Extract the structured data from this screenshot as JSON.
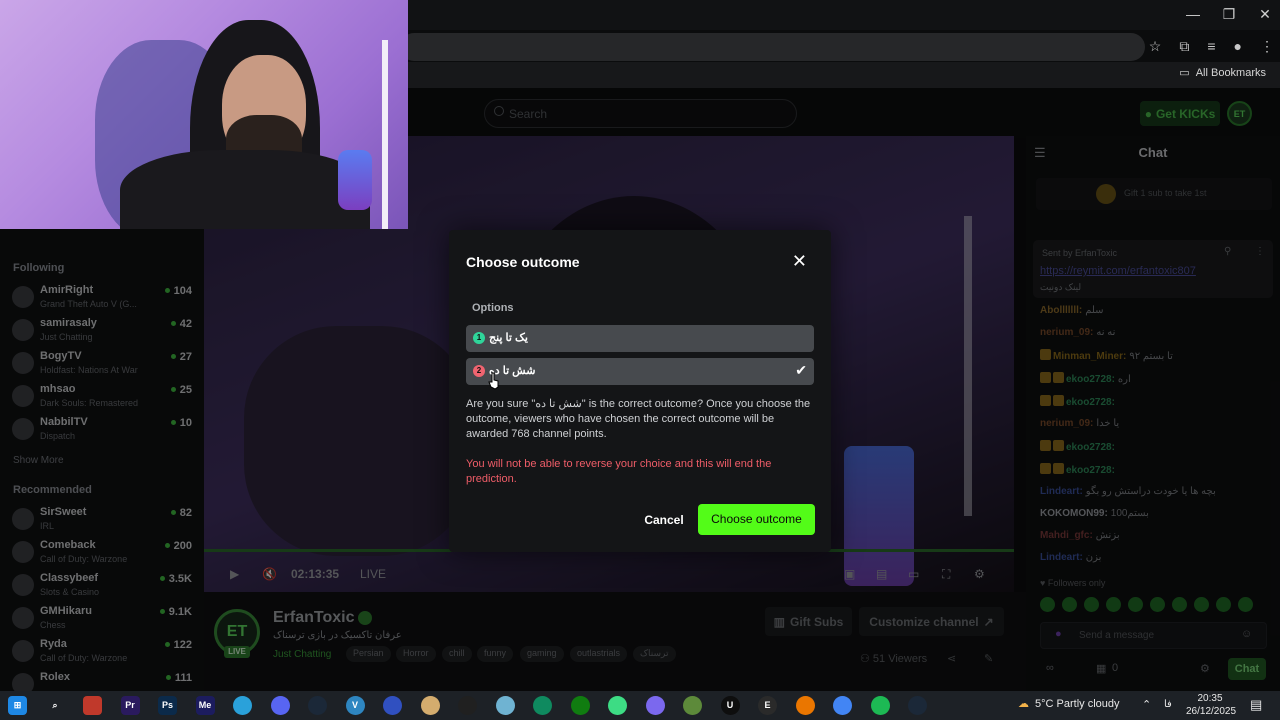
{
  "browser": {
    "bookmarks_label": "All Bookmarks",
    "window_controls": [
      "—",
      "❐",
      "✕"
    ]
  },
  "site": {
    "search_placeholder": "Search",
    "get_kicks_label": "Get KICKs",
    "avatar_initials": "ET"
  },
  "sidebar": {
    "following_heading": "Following",
    "following": [
      {
        "name": "AmirRight",
        "category": "Grand Theft Auto V (G...",
        "count": "104"
      },
      {
        "name": "samirasaly",
        "category": "Just Chatting",
        "count": "42"
      },
      {
        "name": "BogyTV",
        "category": "Holdfast: Nations At War",
        "count": "27"
      },
      {
        "name": "mhsao",
        "category": "Dark Souls: Remastered",
        "count": "25"
      },
      {
        "name": "NabbilTV",
        "category": "Dispatch",
        "count": "10"
      }
    ],
    "show_more": "Show More",
    "recommended_heading": "Recommended",
    "recommended": [
      {
        "name": "SirSweet",
        "category": "IRL",
        "count": "82"
      },
      {
        "name": "Comeback",
        "category": "Call of Duty: Warzone",
        "count": "200"
      },
      {
        "name": "Classybeef",
        "category": "Slots & Casino",
        "count": "3.5K"
      },
      {
        "name": "GMHikaru",
        "category": "Chess",
        "count": "9.1K"
      },
      {
        "name": "Ryda",
        "category": "Call of Duty: Warzone",
        "count": "122"
      },
      {
        "name": "Rolex",
        "category": "",
        "count": "111"
      }
    ]
  },
  "player": {
    "time": "02:13:35",
    "live_label": "LIVE"
  },
  "channel": {
    "name": "ErfanToxic",
    "avatar_text": "ET",
    "live_badge": "LIVE",
    "title": "عرفان تاکسیک در بازی ترسناک",
    "category": "Just Chatting",
    "tags": [
      "Persian",
      "Horror",
      "chill",
      "funny",
      "gaming",
      "outlastrials",
      "ترسناک"
    ],
    "gift_subs": "Gift Subs",
    "customize": "Customize channel",
    "viewers": "51 Viewers"
  },
  "chat": {
    "title": "Chat",
    "gift_banner": "Gift 1 sub to take 1st",
    "pinned_sender": "Sent by  ErfanToxic",
    "pinned_link": "https://reymit.com/erfantoxic807",
    "pinned_text": "لینک دونیت",
    "messages": [
      {
        "user": "Abolllllll:",
        "text": "سلم",
        "color": "#8c6a2a",
        "badges": 0
      },
      {
        "user": "nerium_09:",
        "text": "نه نه",
        "color": "#7a4b2a",
        "badges": 0
      },
      {
        "user": "Minman_Miner:",
        "text": "تا بستم ۹۲",
        "color": "#8a6a1a",
        "badges": 1
      },
      {
        "user": "ekoo2728:",
        "text": "اره",
        "color": "#2f8a5a",
        "badges": 2
      },
      {
        "user": "ekoo2728:",
        "text": "",
        "color": "#2f8a5a",
        "badges": 2
      },
      {
        "user": "nerium_09:",
        "text": "یا خدا",
        "color": "#7a4b2a",
        "badges": 0
      },
      {
        "user": "ekoo2728:",
        "text": "",
        "color": "#2f8a5a",
        "badges": 2
      },
      {
        "user": "ekoo2728:",
        "text": "",
        "color": "#2f8a5a",
        "badges": 2
      },
      {
        "user": "Lindeart:",
        "text": "بچه ها یا خودت دراستش رو بگو",
        "color": "#3a4f9a",
        "badges": 0
      },
      {
        "user": "KOKOMON99:",
        "text": "بستم100",
        "color": "#9a9da2",
        "badges": 0
      },
      {
        "user": "Mahdi_gfc:",
        "text": "بزنش",
        "color": "#7a3a3a",
        "badges": 0
      },
      {
        "user": "Lindeart:",
        "text": "بزن",
        "color": "#3a4f9a",
        "badges": 0
      }
    ],
    "followers_only": "Followers only",
    "input_placeholder": "Send a message",
    "score": "0",
    "send_label": "Chat"
  },
  "modal": {
    "title": "Choose outcome",
    "options_label": "Options",
    "options": [
      {
        "num": "1",
        "label": "یک تا پنج",
        "color": "#2fd59a",
        "selected": false
      },
      {
        "num": "2",
        "label": "شش تا ده",
        "color": "#f06470",
        "selected": true
      }
    ],
    "confirm_text": "Are you sure \"شش تا ده\" is the correct outcome? Once you choose the outcome, viewers who have chosen the correct outcome will be awarded 768 channel points.",
    "warning_text": "You will not be able to reverse your choice and this will end the prediction.",
    "cancel_label": "Cancel",
    "confirm_label": "Choose outcome",
    "accent": "#53fc18"
  },
  "taskbar": {
    "weather": "5°C  Partly cloudy",
    "lang": "فا",
    "time": "20:35",
    "date": "26/12/2025"
  }
}
